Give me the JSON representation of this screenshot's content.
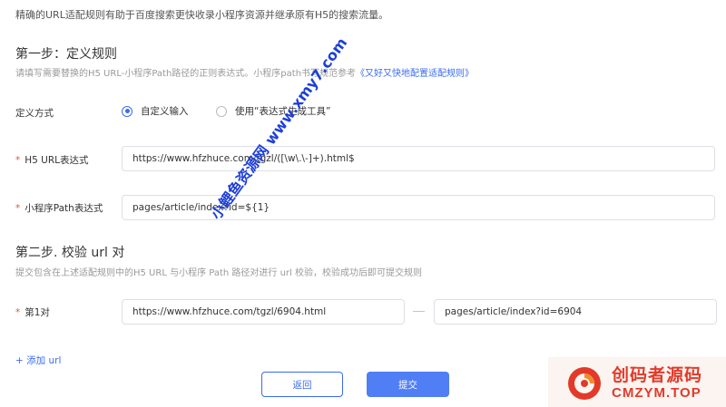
{
  "intro": "精确的URL适配规则有助于百度搜索更快收录小程序资源并继承原有H5的搜索流量。",
  "step1": {
    "title": "第一步：定义规则",
    "desc": "请填写需要替换的H5 URL-小程序Path路径的正则表达式。小程序path书写规范参考",
    "link": "《又好又快地配置适配规则》",
    "method_label": "定义方式",
    "radio_custom": "自定义输入",
    "radio_generator": "使用“表达式生成工具”",
    "h5_label": "H5 URL表达式",
    "h5_value": "https://www.hfzhuce.com/tgzl/([\\w\\.\\-]+).html$",
    "path_label": "小程序Path表达式",
    "path_value": "pages/article/index?id=${1}"
  },
  "step2": {
    "title": "第二步. 校验 url 对",
    "desc": "提交包含在上述适配规则中的H5 URL 与小程序 Path 路径对进行 url 校验，校验成功后即可提交规则",
    "pair_label": "第1对",
    "pair_url": "https://www.hfzhuce.com/tgzl/6904.html",
    "pair_path": "pages/article/index?id=6904"
  },
  "add_url": "+ 添加 url",
  "buttons": {
    "back": "返回",
    "submit": "提交"
  },
  "watermark": "小鲤鱼资源网 www.xmy7.com",
  "logo": {
    "cn": "创码者源码",
    "en": "CMZYM.TOP"
  },
  "colors": {
    "accent": "#3b6cf0",
    "required": "#e5534b",
    "logo_red": "#e23a2a"
  }
}
